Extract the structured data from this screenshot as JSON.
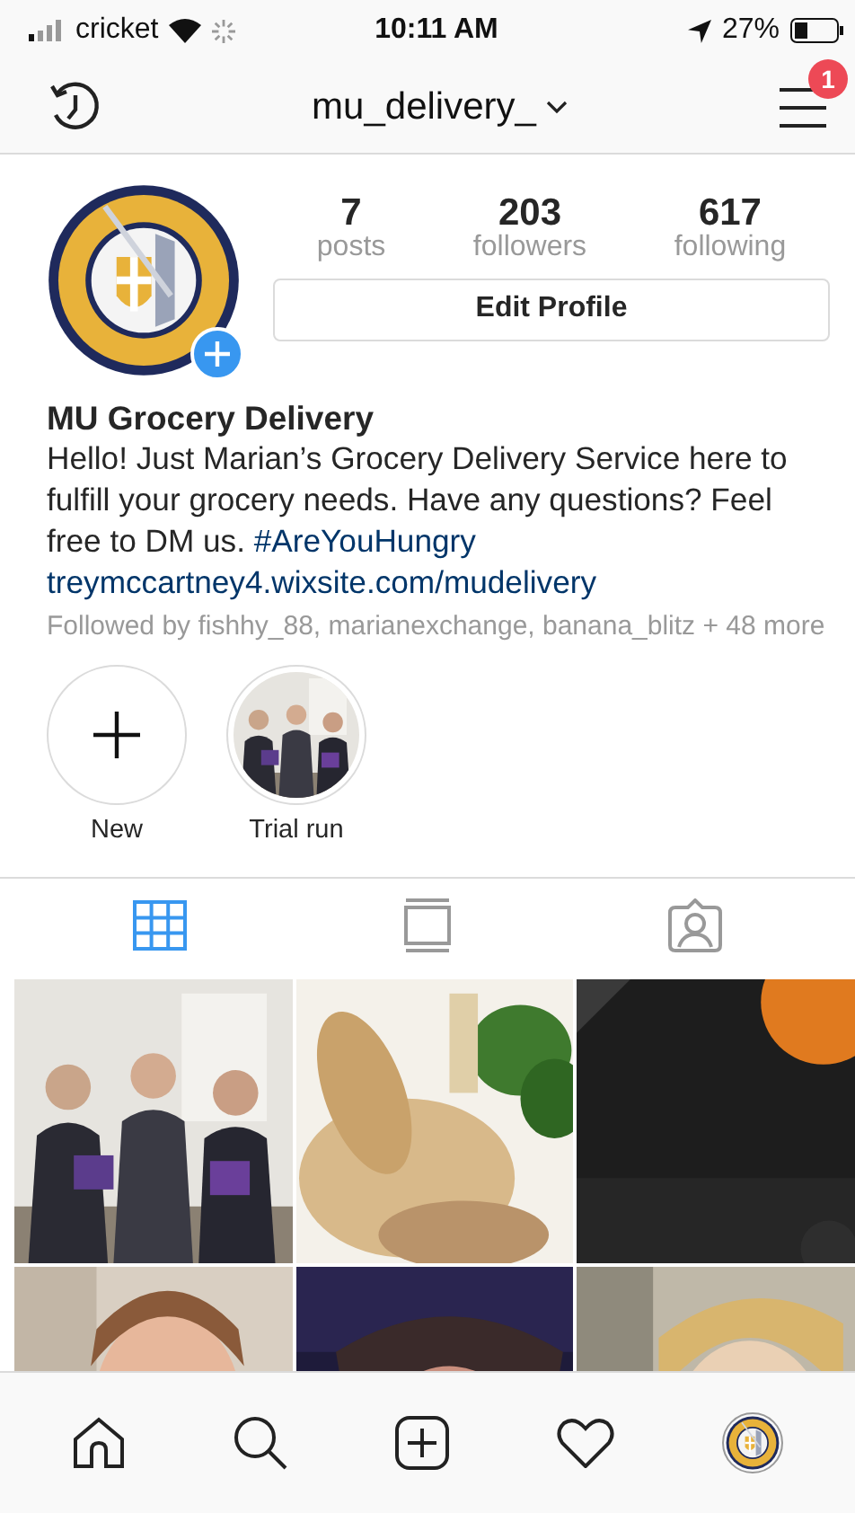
{
  "status_bar": {
    "carrier": "cricket",
    "time": "10:11 AM",
    "battery": "27%"
  },
  "header": {
    "username": "mu_delivery_",
    "notification_count": "1"
  },
  "profile": {
    "stats": [
      {
        "value": "7",
        "label": "posts"
      },
      {
        "value": "203",
        "label": "followers"
      },
      {
        "value": "617",
        "label": "following"
      }
    ],
    "edit_button": "Edit Profile",
    "name": "MU Grocery Delivery",
    "bio": {
      "text": "Hello! Just Marian’s Grocery Delivery Service here to fulfill your grocery needs. Have any questions? Feel free to DM us. ",
      "hashtag": "#AreYouHungry"
    },
    "website": "treymccartney4.wixsite.com/mudelivery",
    "followed_by": "Followed by fishhy_88, marianexchange, banana_blitz + 48 more"
  },
  "highlights": [
    {
      "kind": "new",
      "label": "New"
    },
    {
      "kind": "picture",
      "label": "Trial run"
    }
  ],
  "tabs": [
    {
      "kind": "grid",
      "selected": true
    },
    {
      "kind": "feed",
      "selected": false
    },
    {
      "kind": "tagged",
      "selected": false
    }
  ],
  "nav": [
    {
      "kind": "home"
    },
    {
      "kind": "search"
    },
    {
      "kind": "add"
    },
    {
      "kind": "heart"
    },
    {
      "kind": "profile"
    }
  ]
}
